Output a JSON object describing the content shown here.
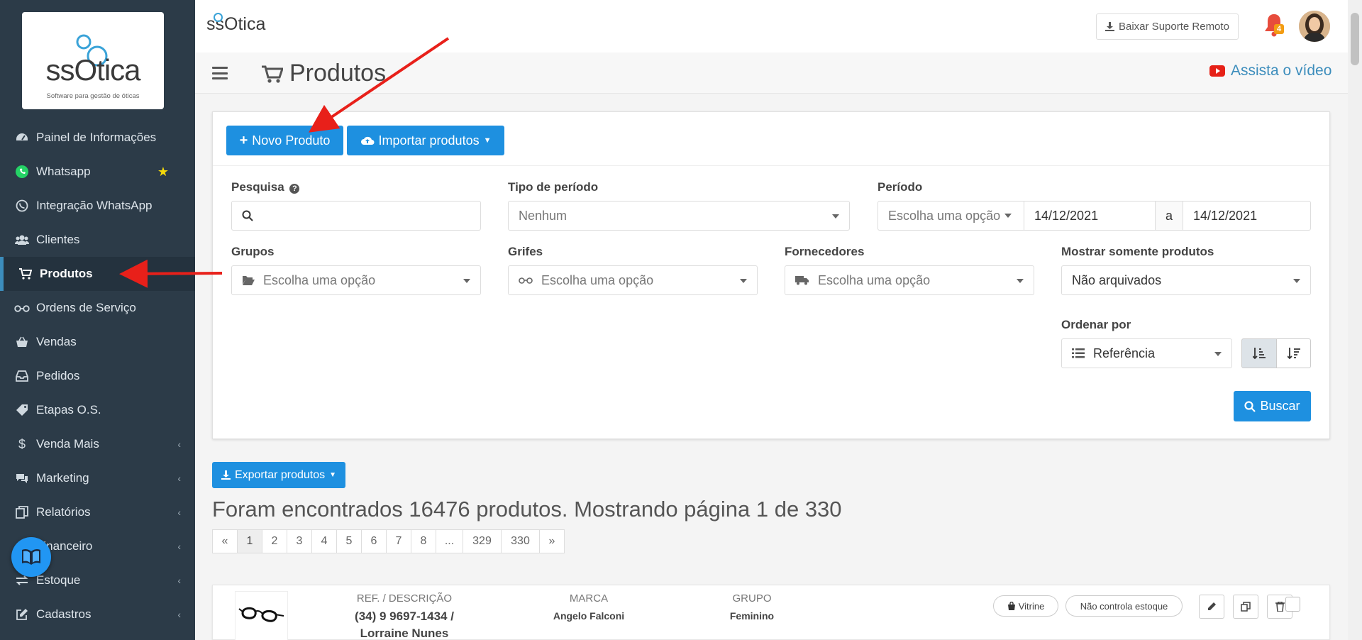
{
  "sidebar": {
    "logo_text": "ssOtica",
    "logo_tagline": "Software para gestão de óticas",
    "items": [
      {
        "label": "Painel de Informações",
        "icon": "dashboard-icon"
      },
      {
        "label": "Whatsapp",
        "icon": "whatsapp-icon",
        "starred": true
      },
      {
        "label": "Integração WhatsApp",
        "icon": "whatsapp-outline-icon"
      },
      {
        "label": "Clientes",
        "icon": "users-icon"
      },
      {
        "label": "Produtos",
        "icon": "cart-icon",
        "active": true
      },
      {
        "label": "Ordens de Serviço",
        "icon": "glasses-icon"
      },
      {
        "label": "Vendas",
        "icon": "basket-icon"
      },
      {
        "label": "Pedidos",
        "icon": "inbox-icon"
      },
      {
        "label": "Etapas O.S.",
        "icon": "tag-icon"
      },
      {
        "label": "Venda Mais",
        "icon": "dollar-icon",
        "submenu": true
      },
      {
        "label": "Marketing",
        "icon": "comments-icon",
        "submenu": true
      },
      {
        "label": "Relatórios",
        "icon": "copy-icon",
        "submenu": true
      },
      {
        "label": "Financeiro",
        "icon": "money-icon",
        "submenu": true
      },
      {
        "label": "Estoque",
        "icon": "exchange-icon",
        "submenu": true
      },
      {
        "label": "Cadastros",
        "icon": "edit-icon",
        "submenu": true
      }
    ]
  },
  "topbar": {
    "logo_text": "ssOtica",
    "remote_support_label": "Baixar Suporte Remoto",
    "notification_count": "4"
  },
  "header": {
    "title": "Produtos",
    "video_link": "Assista o vídeo"
  },
  "filters": {
    "new_product_label": "Novo Produto",
    "import_label": "Importar produtos",
    "search_label": "Pesquisa",
    "search_value": "",
    "period_type_label": "Tipo de período",
    "period_type_value": "Nenhum",
    "period_label": "Período",
    "period_choose": "Escolha uma opção",
    "date_from": "14/12/2021",
    "date_sep": "a",
    "date_to": "14/12/2021",
    "groups_label": "Grupos",
    "groups_value": "Escolha uma opção",
    "brands_label": "Grifes",
    "brands_value": "Escolha uma opção",
    "suppliers_label": "Fornecedores",
    "suppliers_value": "Escolha uma opção",
    "show_only_label": "Mostrar somente produtos",
    "show_only_value": "Não arquivados",
    "order_label": "Ordenar por",
    "order_value": "Referência",
    "search_button": "Buscar"
  },
  "results": {
    "export_label": "Exportar produtos",
    "summary": "Foram encontrados 16476 produtos. Mostrando página 1 de 330",
    "pages": [
      "«",
      "1",
      "2",
      "3",
      "4",
      "5",
      "6",
      "7",
      "8",
      "...",
      "329",
      "330",
      "»"
    ],
    "current_page": "1"
  },
  "product": {
    "col_ref": "REF. / DESCRIÇÃO",
    "ref_line1": "(34) 9 9697-1434 /",
    "ref_line2": "Lorraine Nunes",
    "col_brand": "MARCA",
    "brand": "Angelo Falconi",
    "col_group": "GRUPO",
    "group": "Feminino",
    "showcase_label": "Vitrine",
    "stock_label": "Não controla estoque"
  },
  "colors": {
    "sidebar_bg": "#2c3b48",
    "primary": "#1e90e0",
    "link": "#3c8dbc",
    "annotation_arrow": "#e8201a"
  }
}
